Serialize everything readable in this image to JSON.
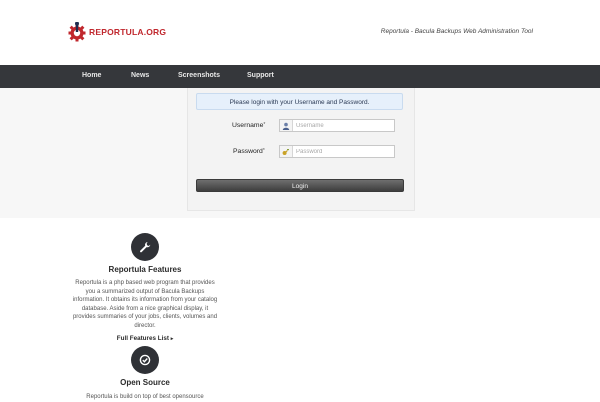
{
  "header": {
    "logo_text": "REPORTULA.ORG",
    "tagline": "Reportula - Bacula Backups Web Administration Tool"
  },
  "nav": {
    "items": [
      {
        "label": "Home"
      },
      {
        "label": "News"
      },
      {
        "label": "Screenshots"
      },
      {
        "label": "Support"
      }
    ]
  },
  "login": {
    "notice": "Please login with your Username and Password.",
    "username_label": "Username",
    "password_label": "Password",
    "required_mark": "*",
    "username_placeholder": "Username",
    "password_placeholder": "Password",
    "button_label": "Login"
  },
  "features": [
    {
      "icon": "wrench-icon",
      "title": "Reportula Features",
      "text": "Reportula is a php based web program that provides you a summarized output of Bacula Backups information. It obtains its information from your catalog database. Aside from a nice graphical display, it provides summaries of your jobs, clients, volumes and director.",
      "link": "Full Features List",
      "link_arrow": "▸"
    },
    {
      "icon": "check-circle-icon",
      "title": "Open Source",
      "text": "Reportula is build on top of best opensource"
    }
  ],
  "colors": {
    "brand_red": "#c0272d",
    "nav_bg": "#35373b",
    "notice_bg": "#e6f0fb"
  }
}
